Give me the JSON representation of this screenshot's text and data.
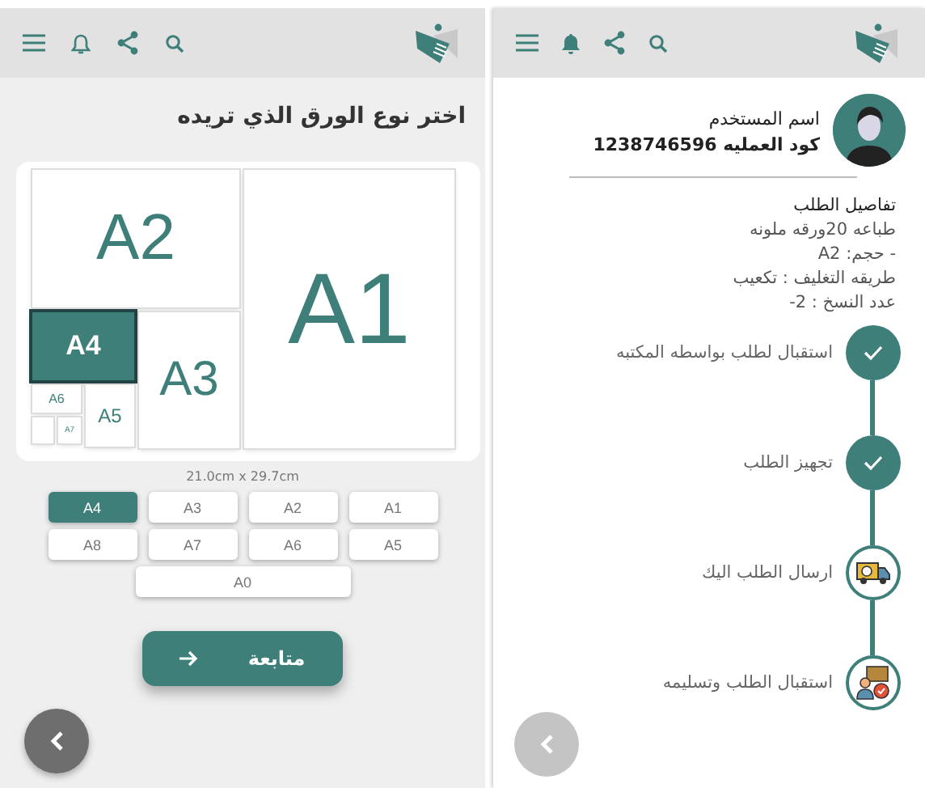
{
  "paper_screen": {
    "title": "اختر نوع الورق الذي تريده",
    "diagram": [
      {
        "label": "A1",
        "selected": false
      },
      {
        "label": "A2",
        "selected": false
      },
      {
        "label": "A3",
        "selected": false
      },
      {
        "label": "A4",
        "selected": true
      },
      {
        "label": "A5",
        "selected": false
      },
      {
        "label": "A6",
        "selected": false
      },
      {
        "label": "A7",
        "selected": false
      }
    ],
    "size_text": "21.0cm x 29.7cm",
    "size_buttons": [
      {
        "label": "A1",
        "selected": false
      },
      {
        "label": "A2",
        "selected": false
      },
      {
        "label": "A3",
        "selected": false
      },
      {
        "label": "A4",
        "selected": true
      },
      {
        "label": "A5",
        "selected": false
      },
      {
        "label": "A6",
        "selected": false
      },
      {
        "label": "A7",
        "selected": false
      },
      {
        "label": "A8",
        "selected": false
      },
      {
        "label": "A0",
        "selected": false
      }
    ],
    "continue_button": "متابعة"
  },
  "order_screen": {
    "user_name": "اسم المستخدم",
    "order_code": "كود العمليه 1238746596",
    "details_title": "تفاصيل الطلب",
    "details": [
      "طباعه 20ورقه ملونه",
      "- حجم: A2",
      "طريقه التغليف : تكعيب",
      "عدد النسخ : 2-"
    ],
    "steps": [
      {
        "label": "استقبال لطلب بواسطه المكتبه",
        "kind": "done"
      },
      {
        "label": "تجهيز الطلب",
        "kind": "done"
      },
      {
        "label": "ارسال الطلب اليك",
        "kind": "truck"
      },
      {
        "label": "استقبال الطلب وتسليمه",
        "kind": "handover"
      }
    ]
  }
}
